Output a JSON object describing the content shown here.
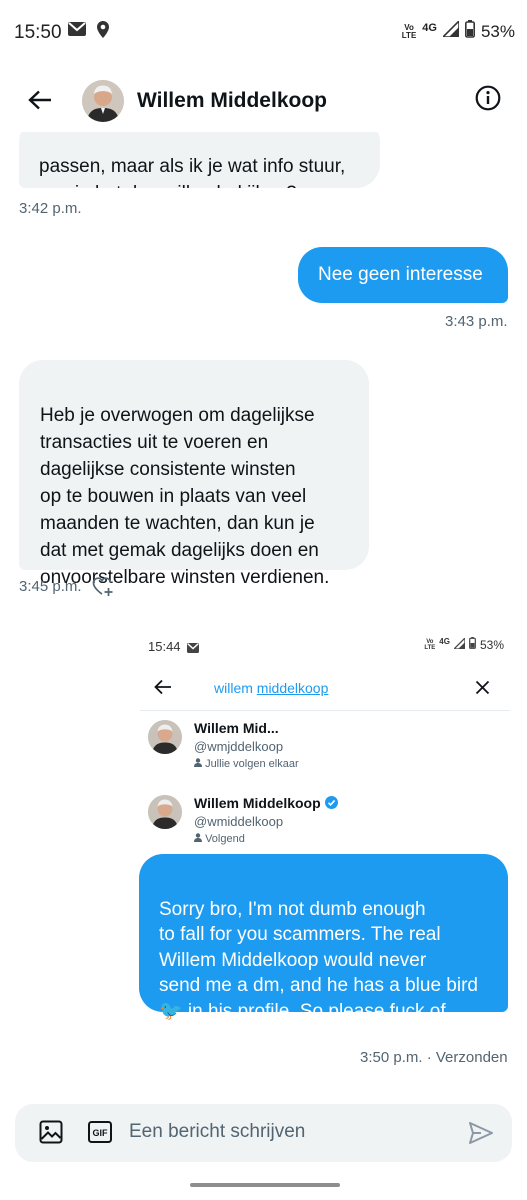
{
  "status_bar": {
    "time": "15:50",
    "network": "4G",
    "battery": "53%"
  },
  "header": {
    "title": "Willem Middelkoop"
  },
  "messages": [
    {
      "text": "passen, maar als ik je wat info stuur,\nzou je het dan willen bekijken?",
      "time": "3:42 p.m."
    },
    {
      "text": "Nee geen interesse",
      "time": "3:43 p.m."
    },
    {
      "text": "Heb je overwogen om dagelijkse\ntransacties uit te voeren en\ndagelijkse consistente winsten\nop te bouwen in plaats van veel\nmaanden te wachten, dan kun je\ndat met gemak dagelijks doen en\nonvoorstelbare winsten verdienen.",
      "time": "3:45 p.m."
    },
    {
      "text": "Sorry bro, I'm not dumb enough\nto fall for you scammers. The real\nWillem Middelkoop would never\nsend me a dm, and he has a blue bird\n🐦 in his profile. So please fuck of.\nAccount is reported for scam btw",
      "time": "3:50 p.m. · Verzonden"
    }
  ],
  "attached_screenshot": {
    "time": "15:44",
    "battery": "53%",
    "network": "4G",
    "search_query_first": "willem",
    "search_query_second": "middelkoop",
    "results": [
      {
        "name": "Willem Mid...",
        "handle": "@wmjddelkoop",
        "meta": "Jullie volgen elkaar",
        "verified": false
      },
      {
        "name": "Willem Middelkoop",
        "handle": "@wmiddelkoop",
        "meta": "Volgend",
        "verified": true
      }
    ]
  },
  "composer": {
    "placeholder": "Een bericht schrijven",
    "gif_label": "GIF"
  },
  "colors": {
    "accent": "#1d9bf0",
    "incoming_bubble": "#eff3f4",
    "muted_text": "#536471"
  },
  "icons": [
    "mail-icon",
    "location-icon",
    "signal-icon",
    "battery-icon",
    "back-arrow-icon",
    "info-icon",
    "heart-plus-icon",
    "image-icon",
    "gif-icon",
    "send-icon",
    "close-icon",
    "verified-badge-icon",
    "person-icon"
  ]
}
